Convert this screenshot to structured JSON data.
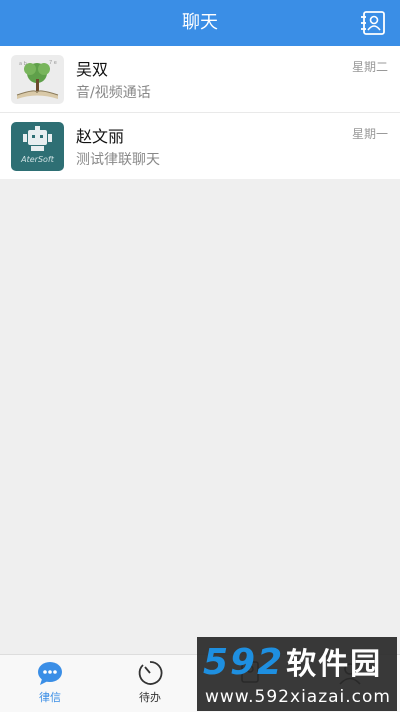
{
  "header": {
    "title": "聊天",
    "contacts_icon": "contacts-book-icon"
  },
  "chats": [
    {
      "name": "吴双",
      "preview": "音/视频通话",
      "time": "星期二",
      "avatar": "tree-book-avatar"
    },
    {
      "name": "赵文丽",
      "preview": "测试律联聊天",
      "time": "星期一",
      "avatar": "robot-logo-avatar",
      "avatar_text": "AterSoft"
    }
  ],
  "tabbar": {
    "tabs": [
      {
        "label": "律信",
        "icon": "chat-bubble-icon",
        "active": true
      },
      {
        "label": "待办",
        "icon": "timer-icon",
        "active": false
      },
      {
        "label": "",
        "icon": "contacts-icon",
        "active": false
      },
      {
        "label": "",
        "icon": "person-icon",
        "active": false
      }
    ]
  },
  "watermark": {
    "brand_num": "592",
    "brand_cn": "软件园",
    "url": "www.592xiazai.com"
  },
  "colors": {
    "accent": "#3a8ee6",
    "background": "#efefef",
    "watermark_blue": "#1e8fe0"
  }
}
